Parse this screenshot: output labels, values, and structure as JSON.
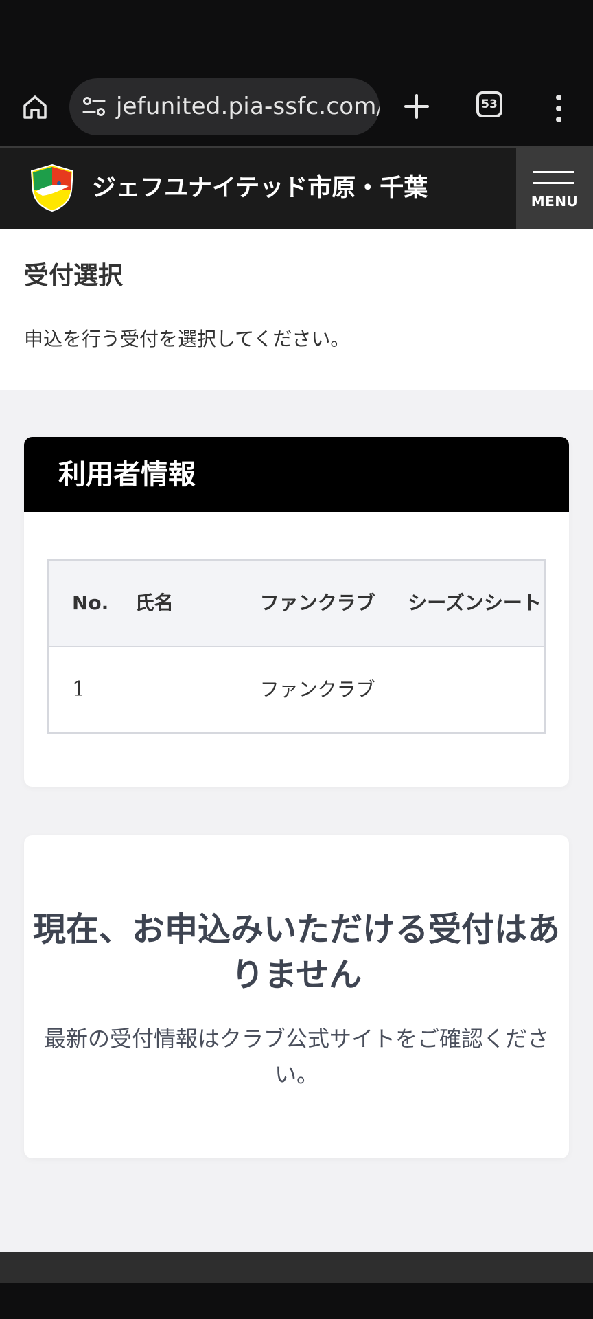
{
  "browser": {
    "url": "jefunited.pia-ssfc.com/n",
    "tab_count": "53"
  },
  "header": {
    "title": "ジェフユナイテッド市原・千葉",
    "menu_label": "MENU"
  },
  "intro": {
    "title": "受付選択",
    "description": "申込を行う受付を選択してください。"
  },
  "user_info": {
    "title": "利用者情報",
    "columns": [
      "No.",
      "氏名",
      "ファンクラブ",
      "シーズンシート"
    ],
    "rows": [
      {
        "no": "1",
        "name": "",
        "fanclub": "ファンクラブ",
        "season_seat": ""
      }
    ]
  },
  "notice": {
    "title": "現在、お申込みいただける受付はありません",
    "text": "最新の受付情報はクラブ公式サイトをご確認ください。"
  },
  "colors": {
    "header_bg": "#1b1b1b",
    "card_head_bg": "#000000",
    "page_bg": "#f2f2f4",
    "table_head_bg": "#f3f4f7",
    "notice_title": "#3e4451"
  }
}
